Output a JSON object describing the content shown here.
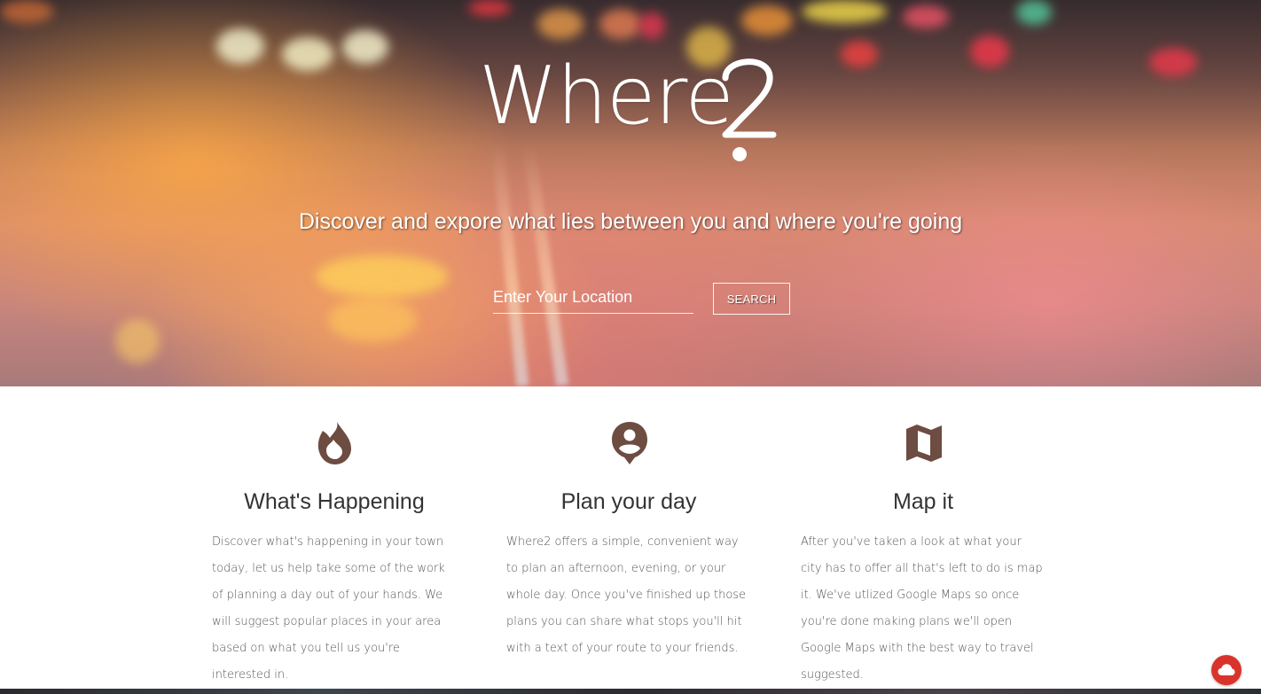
{
  "hero": {
    "logo_text": "Where",
    "tagline": "Discover and expore what lies between you and where you're going",
    "search": {
      "placeholder": "Enter Your Location",
      "value": "",
      "button_label": "SEARCH"
    }
  },
  "features": [
    {
      "icon": "flame-icon",
      "title": "What's Happening",
      "text": "Discover what's happening in your town today, let us help take some of the work of planning a day out of your hands. We will suggest popular places in your area based on what you tell us you're interested in."
    },
    {
      "icon": "person-pin-icon",
      "title": "Plan your day",
      "text": "Where2 offers a simple, convenient way to plan an afternoon, evening, or your whole day. Once you've finished up those plans you can share what stops you'll hit with a text of your route to your friends."
    },
    {
      "icon": "map-icon",
      "title": "Map it",
      "text": "After you've taken a look at what your city has to offer all that's left to do is map it. We've utlized Google Maps so once you're done making plans we'll open Google Maps with the best way to travel suggested."
    }
  ],
  "fab": {
    "icon": "cloud-icon"
  },
  "colors": {
    "icon_brown": "#6d4c41",
    "fab_red": "#d9342b",
    "title_text": "#333333",
    "body_text": "#555555"
  }
}
